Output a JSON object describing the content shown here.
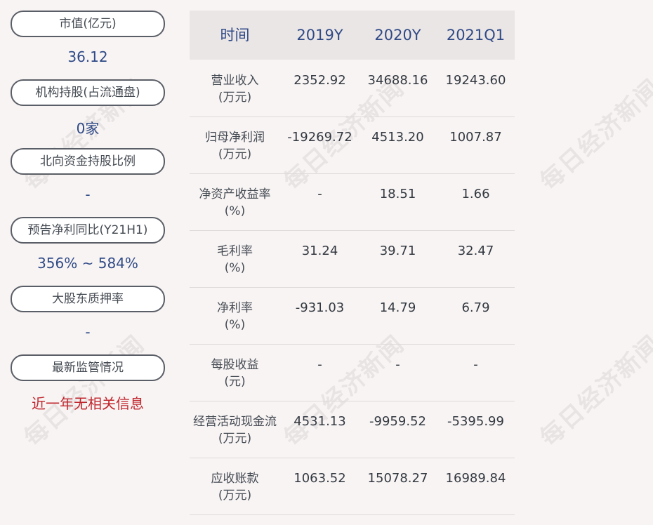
{
  "left_panel": [
    {
      "label": "市值(亿元)",
      "value": "36.12",
      "color": "#2f4a86"
    },
    {
      "label": "机构持股(占流通盘)",
      "value": "0家",
      "color": "#2f4a86"
    },
    {
      "label": "北向资金持股比例",
      "value": "-",
      "color": "#2f4a86"
    },
    {
      "label": "预告净利同比(Y21H1)",
      "value": "356% ~ 584%",
      "color": "#2f4a86"
    },
    {
      "label": "大股东质押率",
      "value": "-",
      "color": "#2f4a86"
    },
    {
      "label": "最新监管情况",
      "value": "近一年无相关信息",
      "color": "#c0262d"
    }
  ],
  "table": {
    "headers": [
      "时间",
      "2019Y",
      "2020Y",
      "2021Q1"
    ],
    "rows": [
      {
        "label": [
          "营业收入",
          "(万元)"
        ],
        "values": [
          "2352.92",
          "34688.16",
          "19243.60"
        ]
      },
      {
        "label": [
          "归母净利润",
          "(万元)"
        ],
        "values": [
          "-19269.72",
          "4513.20",
          "1007.87"
        ]
      },
      {
        "label": [
          "净资产收益率",
          "(%)"
        ],
        "values": [
          "-",
          "18.51",
          "1.66"
        ]
      },
      {
        "label": [
          "毛利率",
          "(%)"
        ],
        "values": [
          "31.24",
          "39.71",
          "32.47"
        ]
      },
      {
        "label": [
          "净利率",
          "(%)"
        ],
        "values": [
          "-931.03",
          "14.79",
          "6.79"
        ]
      },
      {
        "label": [
          "每股收益",
          "(元)"
        ],
        "values": [
          "-",
          "-",
          "-"
        ]
      },
      {
        "label": [
          "经营活动现金流",
          "(万元)"
        ],
        "values": [
          "4531.13",
          "-9959.52",
          "-5395.99"
        ]
      },
      {
        "label": [
          "应收账款",
          "(万元)"
        ],
        "values": [
          "1063.52",
          "15078.27",
          "16989.84"
        ]
      }
    ]
  },
  "watermark": "每日经济新闻"
}
